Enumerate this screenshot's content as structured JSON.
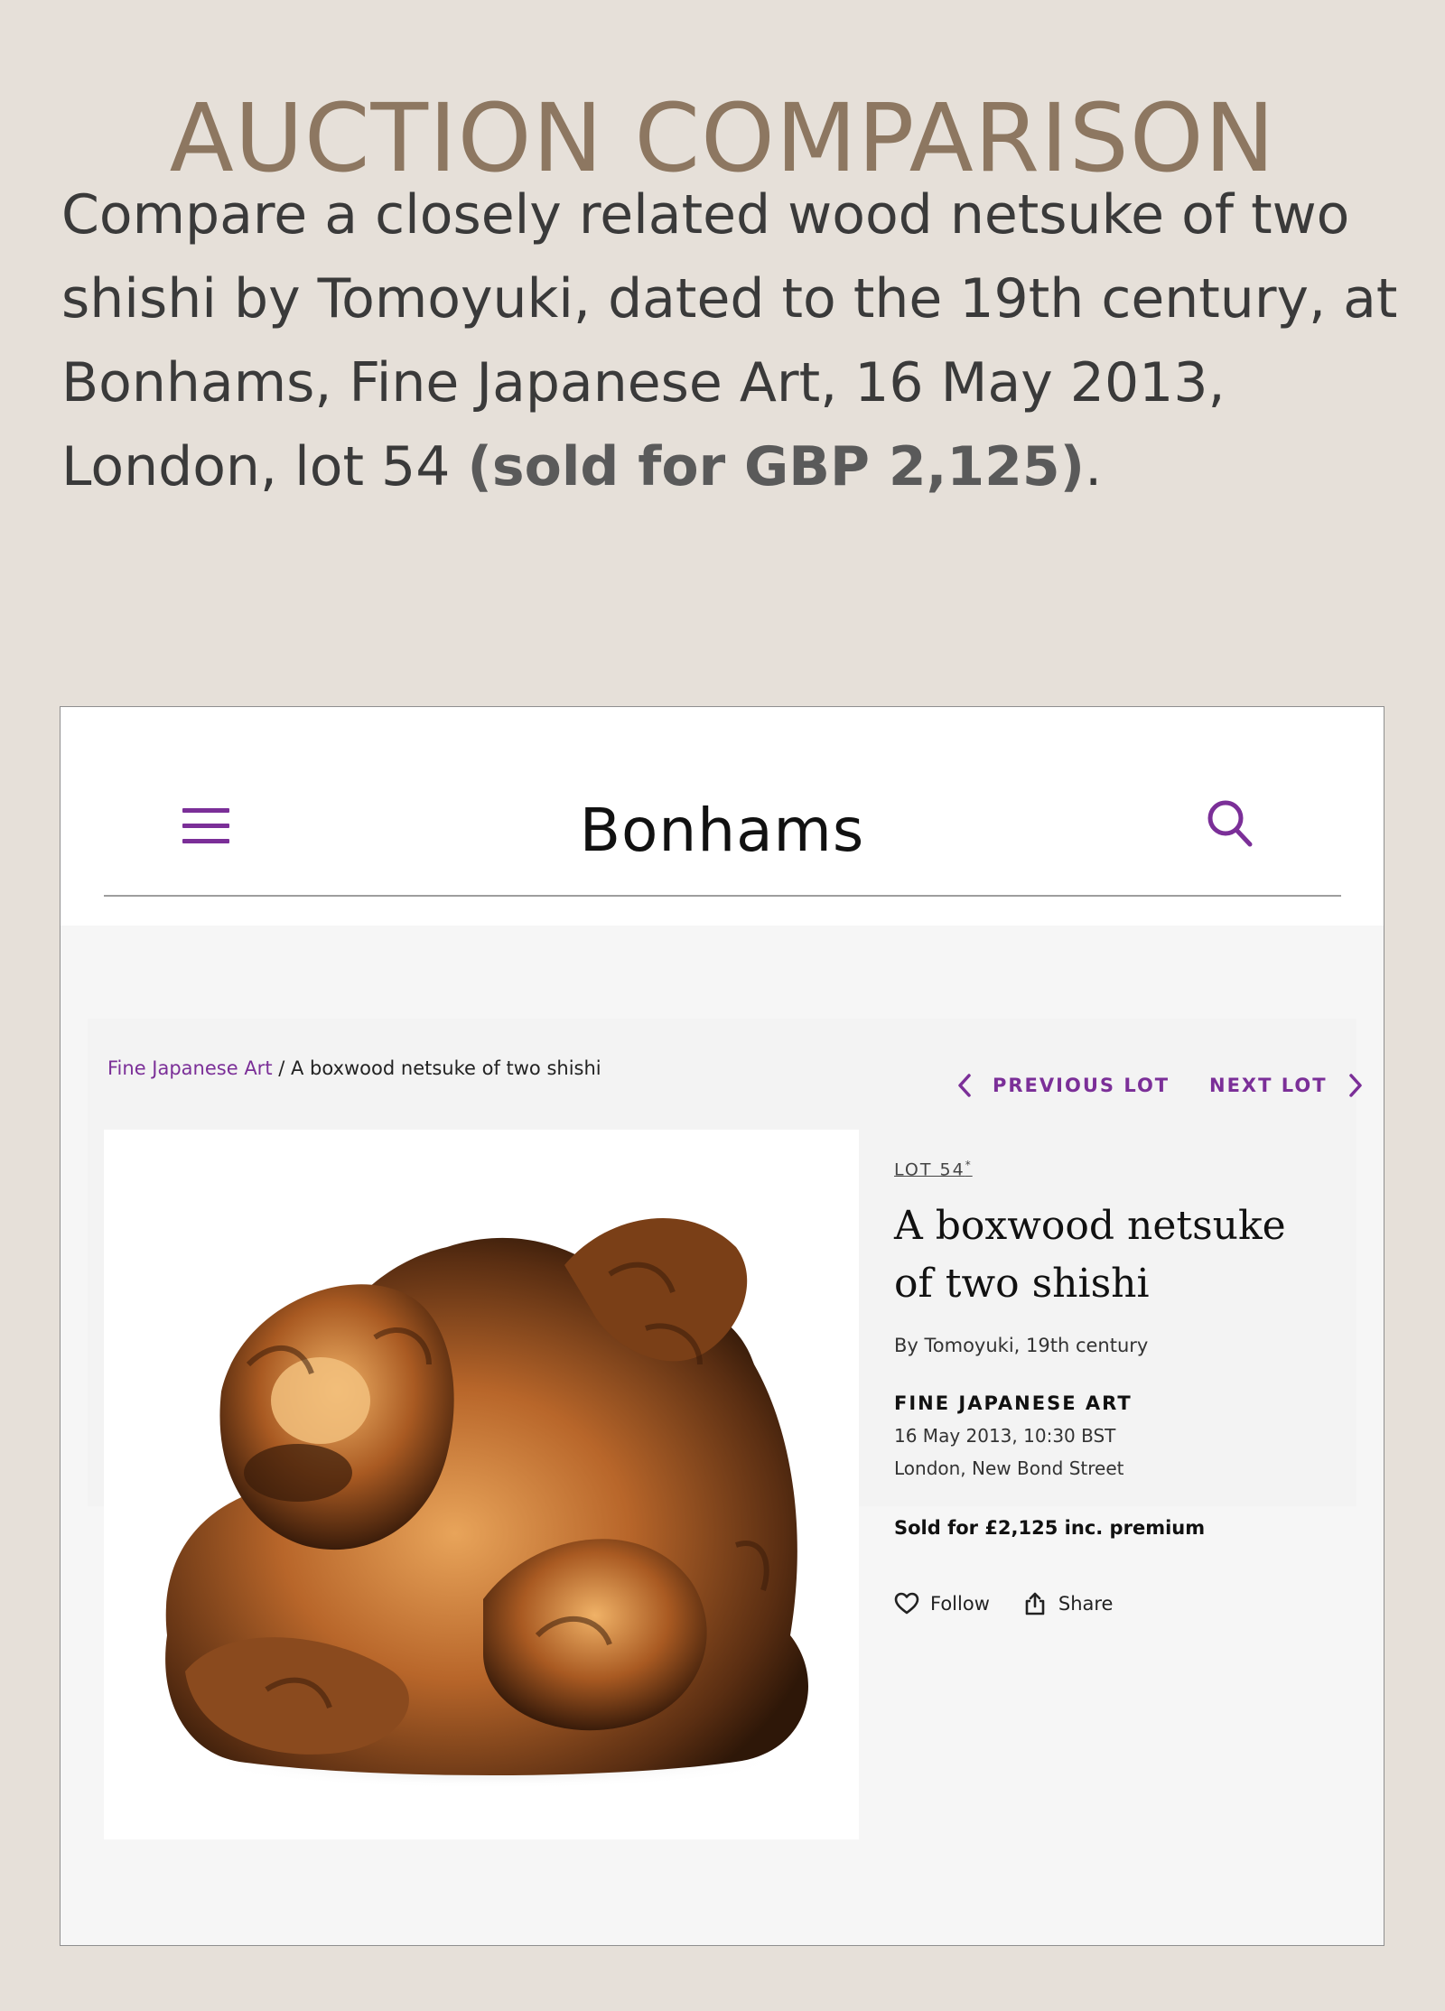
{
  "page": {
    "title": "AUCTION COMPARISON",
    "intro_text": "Compare a closely related wood netsuke of two shishi by Tomoyuki, dated to the 19th century, at Bonhams, Fine Japanese Art, 16 May 2013, London, lot 54 ",
    "intro_sold": "(sold for GBP 2,125)",
    "intro_end": "."
  },
  "site": {
    "logo": "Bonhams",
    "accent_color": "#7b2f98",
    "menu_icon": "hamburger-menu-icon",
    "search_icon": "search-icon"
  },
  "breadcrumb": {
    "link": "Fine Japanese Art",
    "separator": " / ",
    "current": "A boxwood netsuke of two shishi"
  },
  "nav": {
    "previous": "PREVIOUS LOT",
    "next": "NEXT LOT"
  },
  "lot": {
    "number": "LOT 54",
    "number_mark": "*",
    "title_line1": "A boxwood netsuke",
    "title_line2": "of two shishi",
    "byline": "By Tomoyuki, 19th century",
    "sale_name": "FINE JAPANESE ART",
    "sale_date": "16 May 2013, 10:30 BST",
    "sale_location": "London, New Bond Street",
    "sold": "Sold for £2,125 inc. premium"
  },
  "actions": {
    "follow": "Follow",
    "share": "Share"
  }
}
